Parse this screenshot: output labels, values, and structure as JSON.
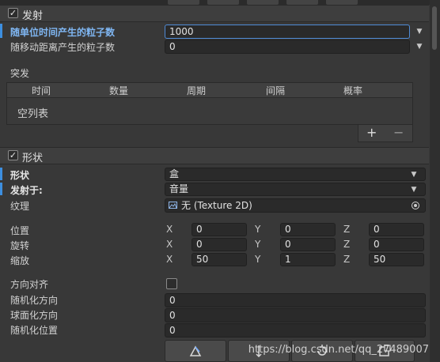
{
  "emission": {
    "title": "发射",
    "rate_over_time_label": "随单位时间产生的粒子数",
    "rate_over_time_value": "1000",
    "rate_over_distance_label": "随移动距离产生的粒子数",
    "rate_over_distance_value": "0",
    "bursts_label": "突发",
    "bursts_columns": [
      "时间",
      "数量",
      "周期",
      "间隔",
      "概率"
    ],
    "bursts_empty": "空列表",
    "add_symbol": "+",
    "remove_symbol": "−"
  },
  "shape": {
    "title": "形状",
    "shape_label": "形状",
    "shape_value": "盒",
    "emit_from_label": "发射于:",
    "emit_from_value": "音量",
    "texture_label": "纹理",
    "texture_value": "无 (Texture 2D)",
    "texture_icon": "image-icon",
    "position_label": "位置",
    "rotation_label": "旋转",
    "scale_label": "缩放",
    "axis_x": "X",
    "axis_y": "Y",
    "axis_z": "Z",
    "position": [
      "0",
      "0",
      "0"
    ],
    "rotation": [
      "0",
      "0",
      "0"
    ],
    "scale": [
      "50",
      "1",
      "50"
    ],
    "align_to_direction_label": "方向对齐",
    "randomize_direction_label": "随机化方向",
    "randomize_direction_value": "0",
    "spherize_direction_label": "球面化方向",
    "spherize_direction_value": "0",
    "randomize_position_label": "随机化位置",
    "randomize_position_value": "0"
  },
  "watermark": "https://blog.csdn.net/qq_27489007",
  "colors": {
    "background": "#383838",
    "field": "#2a2a2a",
    "accent": "#3d8fe0",
    "active_border": "#4f8bd6"
  }
}
